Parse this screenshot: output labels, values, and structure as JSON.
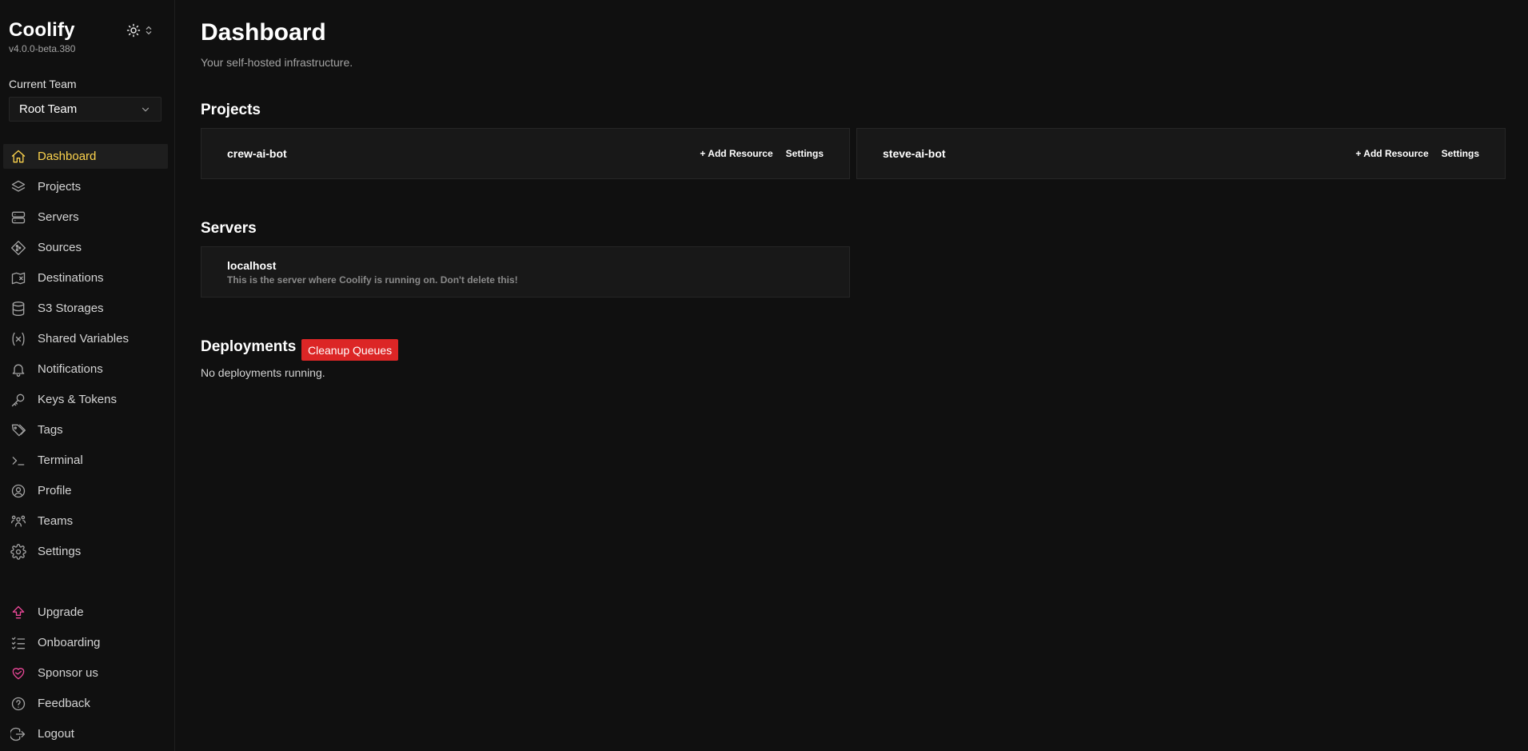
{
  "brand": {
    "name": "Coolify",
    "version": "v4.0.0-beta.380"
  },
  "team": {
    "label": "Current Team",
    "selected": "Root Team"
  },
  "nav": [
    {
      "label": "Dashboard",
      "icon": "home-icon",
      "active": true
    },
    {
      "label": "Projects",
      "icon": "layers-icon"
    },
    {
      "label": "Servers",
      "icon": "server-icon"
    },
    {
      "label": "Sources",
      "icon": "git-icon"
    },
    {
      "label": "Destinations",
      "icon": "map-icon"
    },
    {
      "label": "S3 Storages",
      "icon": "database-icon"
    },
    {
      "label": "Shared Variables",
      "icon": "variable-icon"
    },
    {
      "label": "Notifications",
      "icon": "bell-icon"
    },
    {
      "label": "Keys & Tokens",
      "icon": "key-icon"
    },
    {
      "label": "Tags",
      "icon": "tag-icon"
    },
    {
      "label": "Terminal",
      "icon": "terminal-icon"
    },
    {
      "label": "Profile",
      "icon": "user-circle-icon"
    },
    {
      "label": "Teams",
      "icon": "users-icon"
    },
    {
      "label": "Settings",
      "icon": "gear-icon"
    }
  ],
  "nav_bottom": [
    {
      "label": "Upgrade",
      "icon": "upgrade-arrow-icon"
    },
    {
      "label": "Onboarding",
      "icon": "checklist-icon"
    },
    {
      "label": "Sponsor us",
      "icon": "heart-icon"
    },
    {
      "label": "Feedback",
      "icon": "help-circle-icon"
    },
    {
      "label": "Logout",
      "icon": "logout-icon"
    }
  ],
  "page": {
    "title": "Dashboard",
    "subtitle": "Your self-hosted infrastructure."
  },
  "projects": {
    "title": "Projects",
    "items": [
      {
        "name": "crew-ai-bot",
        "add_label": "+ Add Resource",
        "settings_label": "Settings"
      },
      {
        "name": "steve-ai-bot",
        "add_label": "+ Add Resource",
        "settings_label": "Settings"
      }
    ]
  },
  "servers": {
    "title": "Servers",
    "items": [
      {
        "name": "localhost",
        "description": "This is the server where Coolify is running on. Don't delete this!"
      }
    ]
  },
  "deployments": {
    "title": "Deployments",
    "cleanup_label": "Cleanup Queues",
    "empty_text": "No deployments running."
  },
  "colors": {
    "accent": "#fcd34d",
    "danger": "#dc2626",
    "pink": "#ec4899",
    "background": "#101010"
  }
}
